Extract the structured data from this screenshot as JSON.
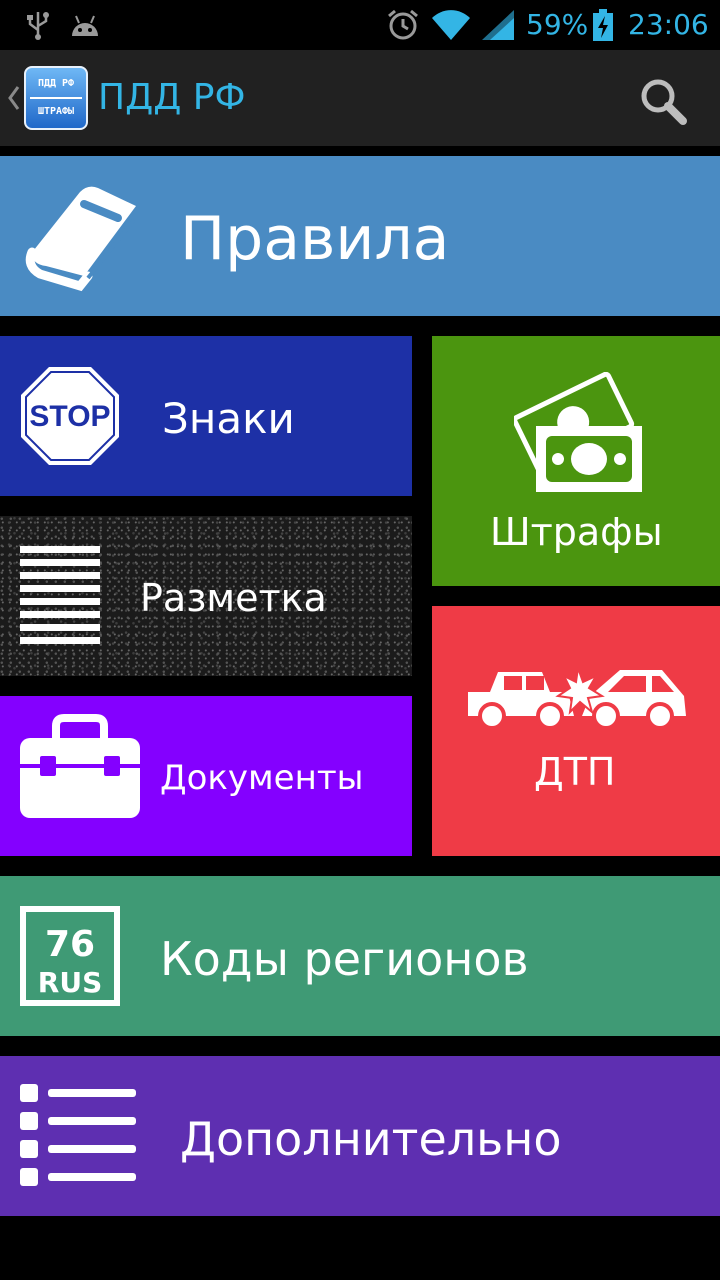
{
  "status_bar": {
    "battery_percent": "59%",
    "time": "23:06",
    "icons": [
      "usb-icon",
      "android-icon",
      "alarm-icon",
      "wifi-icon",
      "signal-icon",
      "battery-charging-icon"
    ]
  },
  "action_bar": {
    "title": "ПДД РФ",
    "app_icon_line1": "ПДД РФ",
    "app_icon_line2": "ШТРАФЫ",
    "search_icon": "search-icon",
    "back_icon": "chevron-left-icon"
  },
  "tiles": {
    "rules": {
      "label": "Правила",
      "color": "#4a8bc3",
      "icon": "book-icon"
    },
    "signs": {
      "label": "Знаки",
      "color": "#1d30a6",
      "icon": "stop-sign-icon",
      "icon_text": "STOP"
    },
    "marking": {
      "label": "Разметка",
      "icon": "road-marking-icon"
    },
    "documents": {
      "label": "Документы",
      "color": "#8400ff",
      "icon": "briefcase-icon"
    },
    "fines": {
      "label": "Штрафы",
      "color": "#4b950f",
      "icon": "money-icon"
    },
    "accident": {
      "label": "ДТП",
      "color": "#ef3b46",
      "icon": "car-crash-icon"
    },
    "regions": {
      "label": "Коды регионов",
      "color": "#3f9a75",
      "icon": "license-plate-icon",
      "icon_number": "76",
      "icon_country": "RUS"
    },
    "extra": {
      "label": "Дополнительно",
      "color": "#5e2fb1",
      "icon": "list-icon"
    }
  }
}
